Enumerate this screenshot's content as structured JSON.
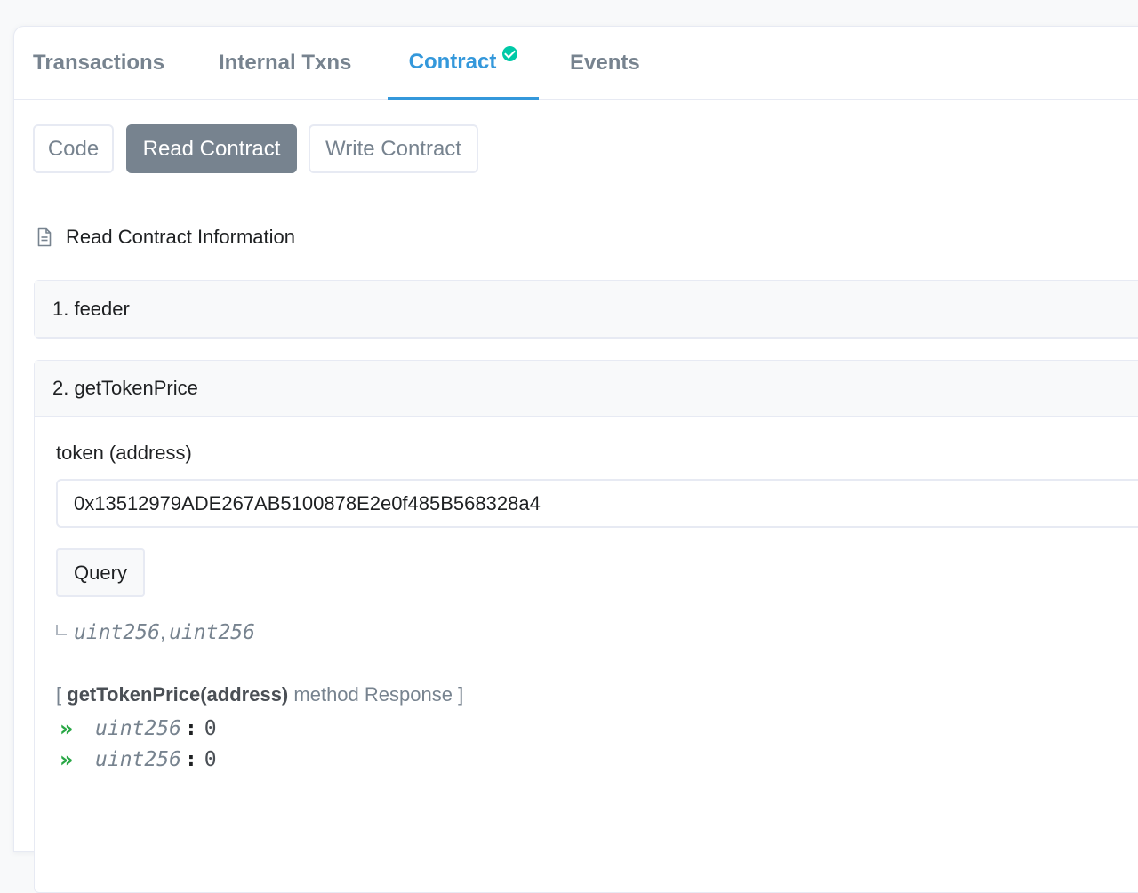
{
  "tabs": [
    {
      "label": "Transactions",
      "active": false
    },
    {
      "label": "Internal Txns",
      "active": false
    },
    {
      "label": "Contract",
      "active": true,
      "verified": true
    },
    {
      "label": "Events",
      "active": false
    }
  ],
  "subtabs": {
    "code": "Code",
    "read": "Read Contract",
    "write": "Write Contract",
    "active": "read"
  },
  "section": {
    "title": "Read Contract Information",
    "icon": "document-icon"
  },
  "functions": [
    {
      "label": "1. feeder"
    },
    {
      "label": "2. getTokenPrice"
    }
  ],
  "getTokenPrice": {
    "param_label": "token (address)",
    "param_value": "0x13512979ADE267AB5100878E2e0f485B568328a4",
    "query_label": "Query",
    "returns": [
      "uint256",
      "uint256"
    ],
    "returns_sep": ",",
    "response": {
      "open": "[",
      "method": "getTokenPrice(address)",
      "suffix": "method Response",
      "close": "]"
    },
    "outputs": [
      {
        "type": "uint256",
        "value": "0"
      },
      {
        "type": "uint256",
        "value": "0"
      }
    ]
  },
  "colors": {
    "accent": "#3498db",
    "verified": "#00c9a7",
    "success": "#28a745",
    "muted": "#77838f"
  }
}
